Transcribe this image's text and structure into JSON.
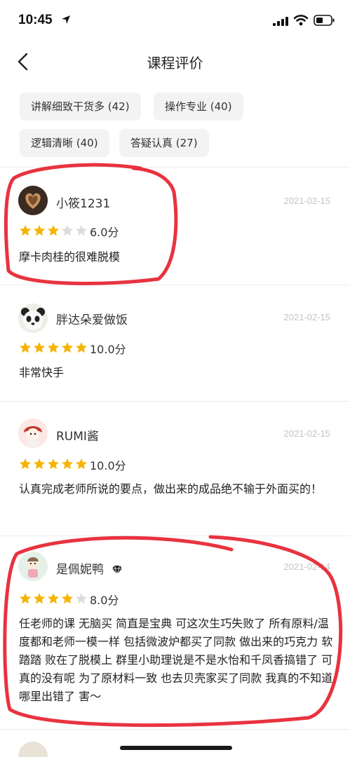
{
  "status": {
    "time": "10:45"
  },
  "header": {
    "title": "课程评价",
    "back": "back"
  },
  "tags": [
    "讲解细致干货多 (42)",
    "操作专业 (40)",
    "逻辑清晰 (40)",
    "答疑认真 (27)"
  ],
  "reviews": [
    {
      "user": "小筱1231",
      "date": "2021-02-15",
      "stars": 3,
      "score": "6.0分",
      "text": "摩卡肉桂的很难脱模"
    },
    {
      "user": "胖达朵爱做饭",
      "date": "2021-02-15",
      "stars": 5,
      "score": "10.0分",
      "text": "非常快手"
    },
    {
      "user": "RUMI酱",
      "date": "2021-02-15",
      "stars": 5,
      "score": "10.0分",
      "text": "认真完成老师所说的要点，做出来的成品绝不输于外面买的！"
    },
    {
      "user": "是佩妮鸭",
      "date": "2021-02-14",
      "stars": 4,
      "score": "8.0分",
      "badge": "diamond-icon",
      "text": "任老师的课 无脑买 简直是宝典 可这次生巧失败了 所有原料/温度都和老师一模一样 包括微波炉都买了同款 做出来的巧克力 软踏踏 败在了脱模上 群里小助理说是不是水怡和千凤香搞错了 可真的没有呢 为了原材料一致 也去贝壳家买了同款 我真的不知道哪里出错了 害～"
    }
  ],
  "colors": {
    "star": "#f5b400",
    "star_empty": "#dcdcdc",
    "annotation": "#e8333f"
  }
}
